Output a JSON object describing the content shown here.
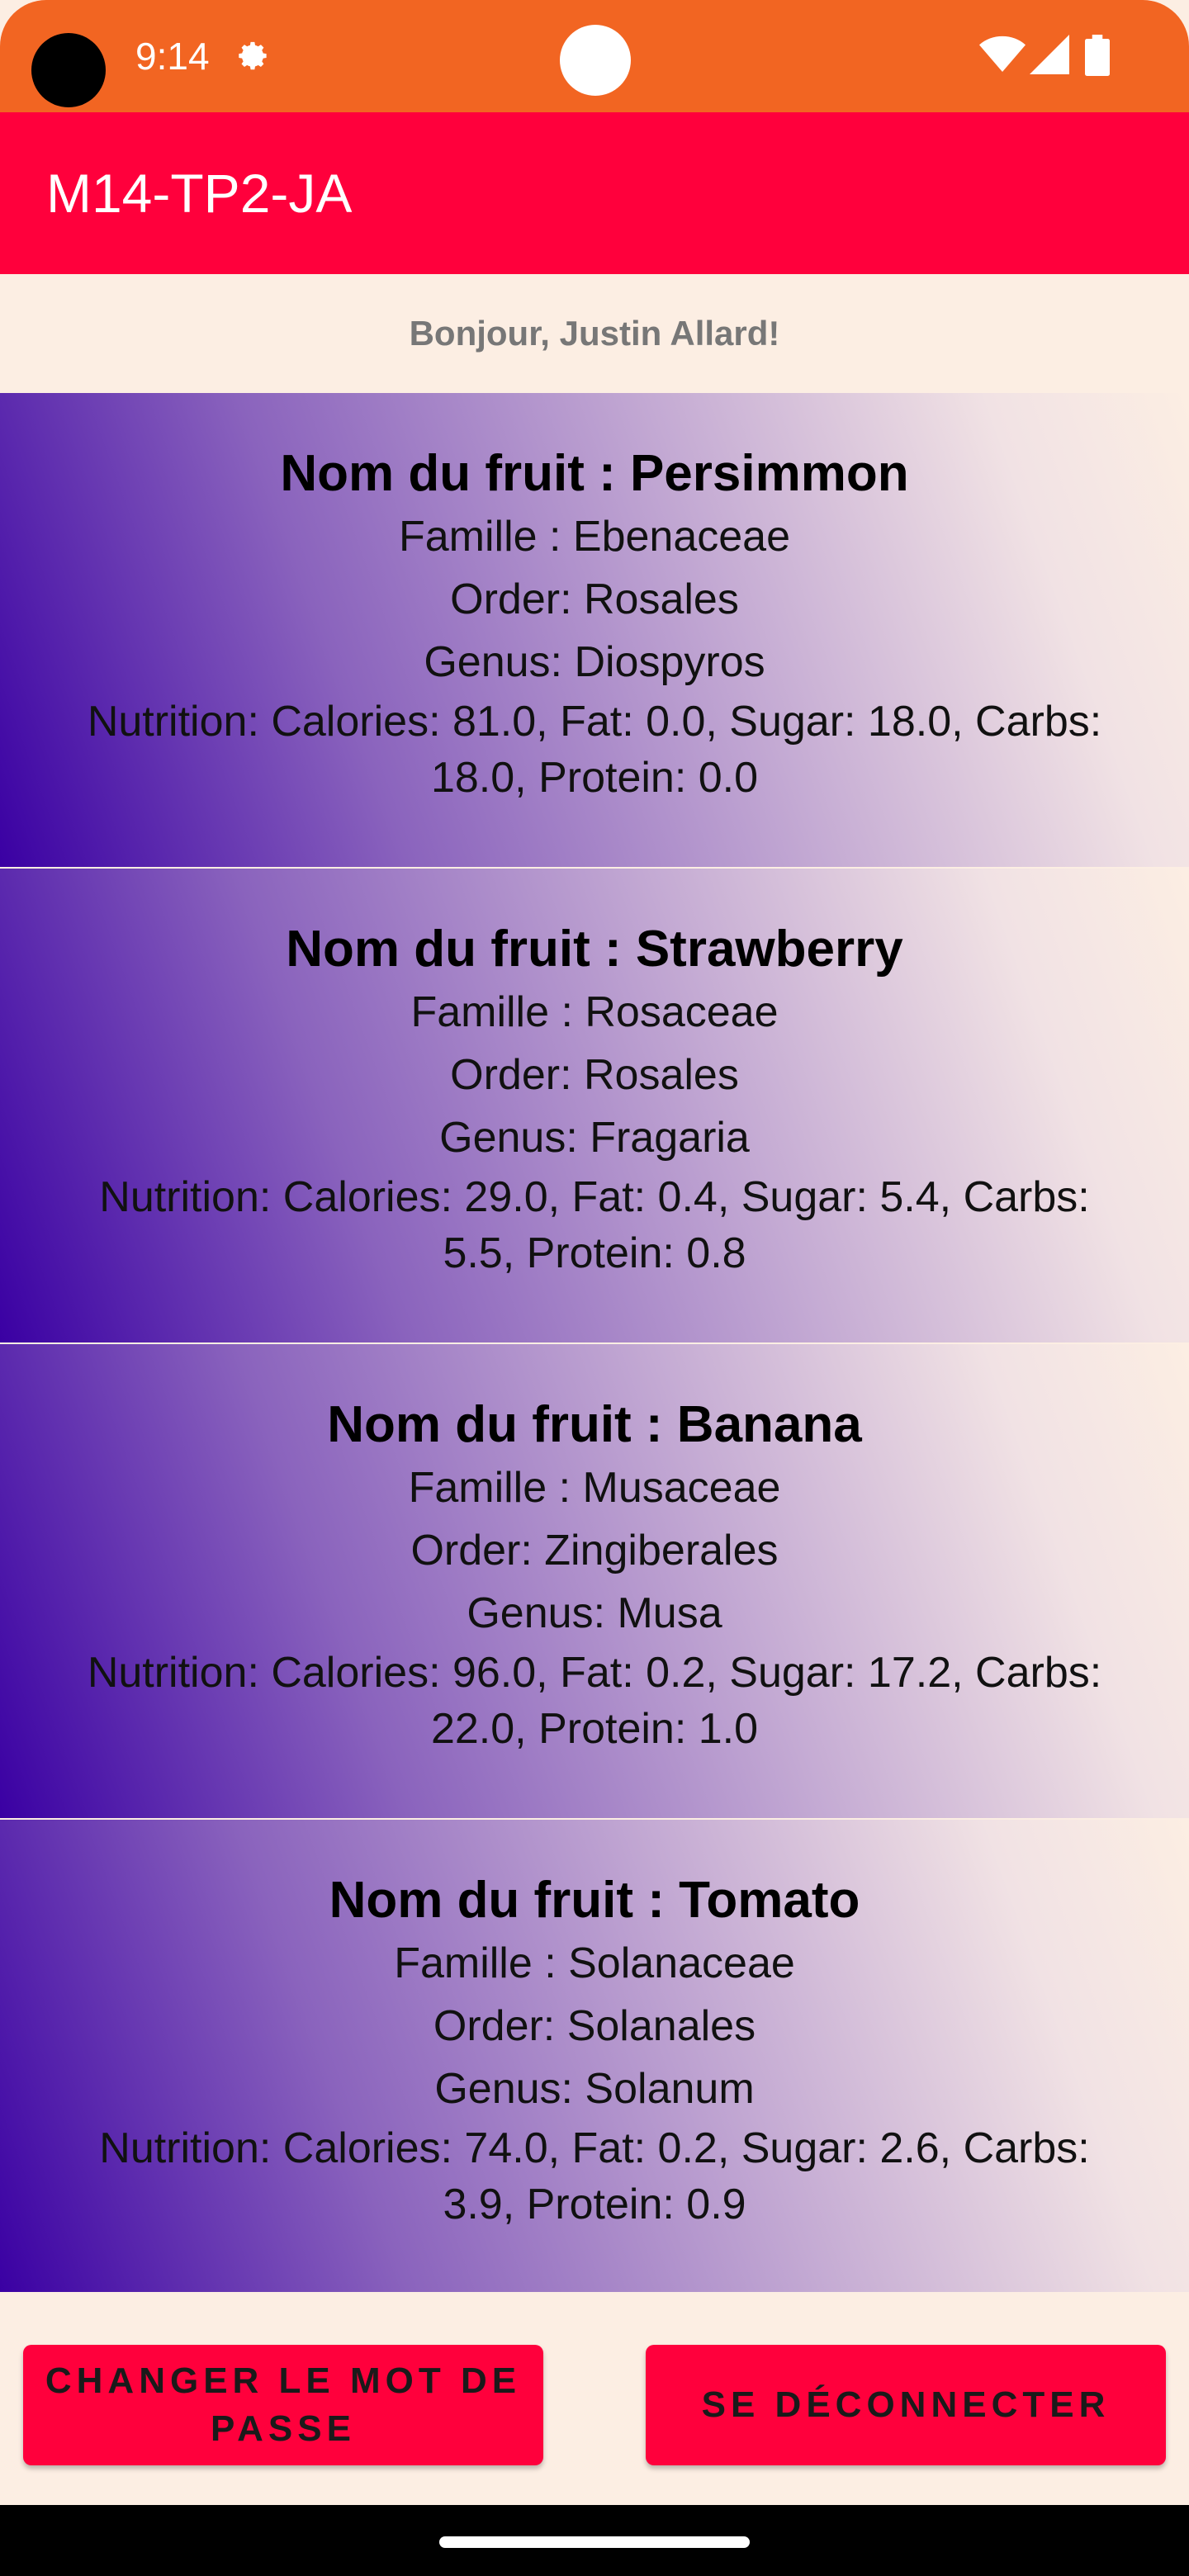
{
  "status_bar": {
    "time": "9:14",
    "icons": [
      "settings-icon",
      "wifi-icon",
      "signal-icon",
      "battery-icon"
    ],
    "color": "#F26522"
  },
  "app_bar": {
    "title": "M14-TP2-JA",
    "color": "#FF003C"
  },
  "greeting": "Bonjour, Justin Allard!",
  "fruits": [
    {
      "name": "Nom du fruit : Persimmon",
      "family": "Famille : Ebenaceae",
      "order": "Order: Rosales",
      "genus": "Genus: Diospyros",
      "nutrition": "Nutrition: Calories: 81.0, Fat: 0.0, Sugar: 18.0, Carbs: 18.0, Protein: 0.0"
    },
    {
      "name": "Nom du fruit : Strawberry",
      "family": "Famille : Rosaceae",
      "order": "Order: Rosales",
      "genus": "Genus: Fragaria",
      "nutrition": "Nutrition: Calories: 29.0, Fat: 0.4, Sugar: 5.4, Carbs: 5.5, Protein: 0.8"
    },
    {
      "name": "Nom du fruit : Banana",
      "family": "Famille : Musaceae",
      "order": "Order: Zingiberales",
      "genus": "Genus: Musa",
      "nutrition": "Nutrition: Calories: 96.0, Fat: 0.2, Sugar: 17.2, Carbs: 22.0, Protein: 1.0"
    },
    {
      "name": "Nom du fruit : Tomato",
      "family": "Famille : Solanaceae",
      "order": "Order: Solanales",
      "genus": "Genus: Solanum",
      "nutrition": "Nutrition: Calories: 74.0, Fat: 0.2, Sugar: 2.6, Carbs: 3.9, Protein: 0.9"
    }
  ],
  "buttons": {
    "change_password": "CHANGER LE MOT DE PASSE",
    "logout": "SE DÉCONNECTER"
  },
  "colors": {
    "background": "#FCEEE3",
    "accent": "#FF003C",
    "gradient_start": "#3A00A3"
  }
}
